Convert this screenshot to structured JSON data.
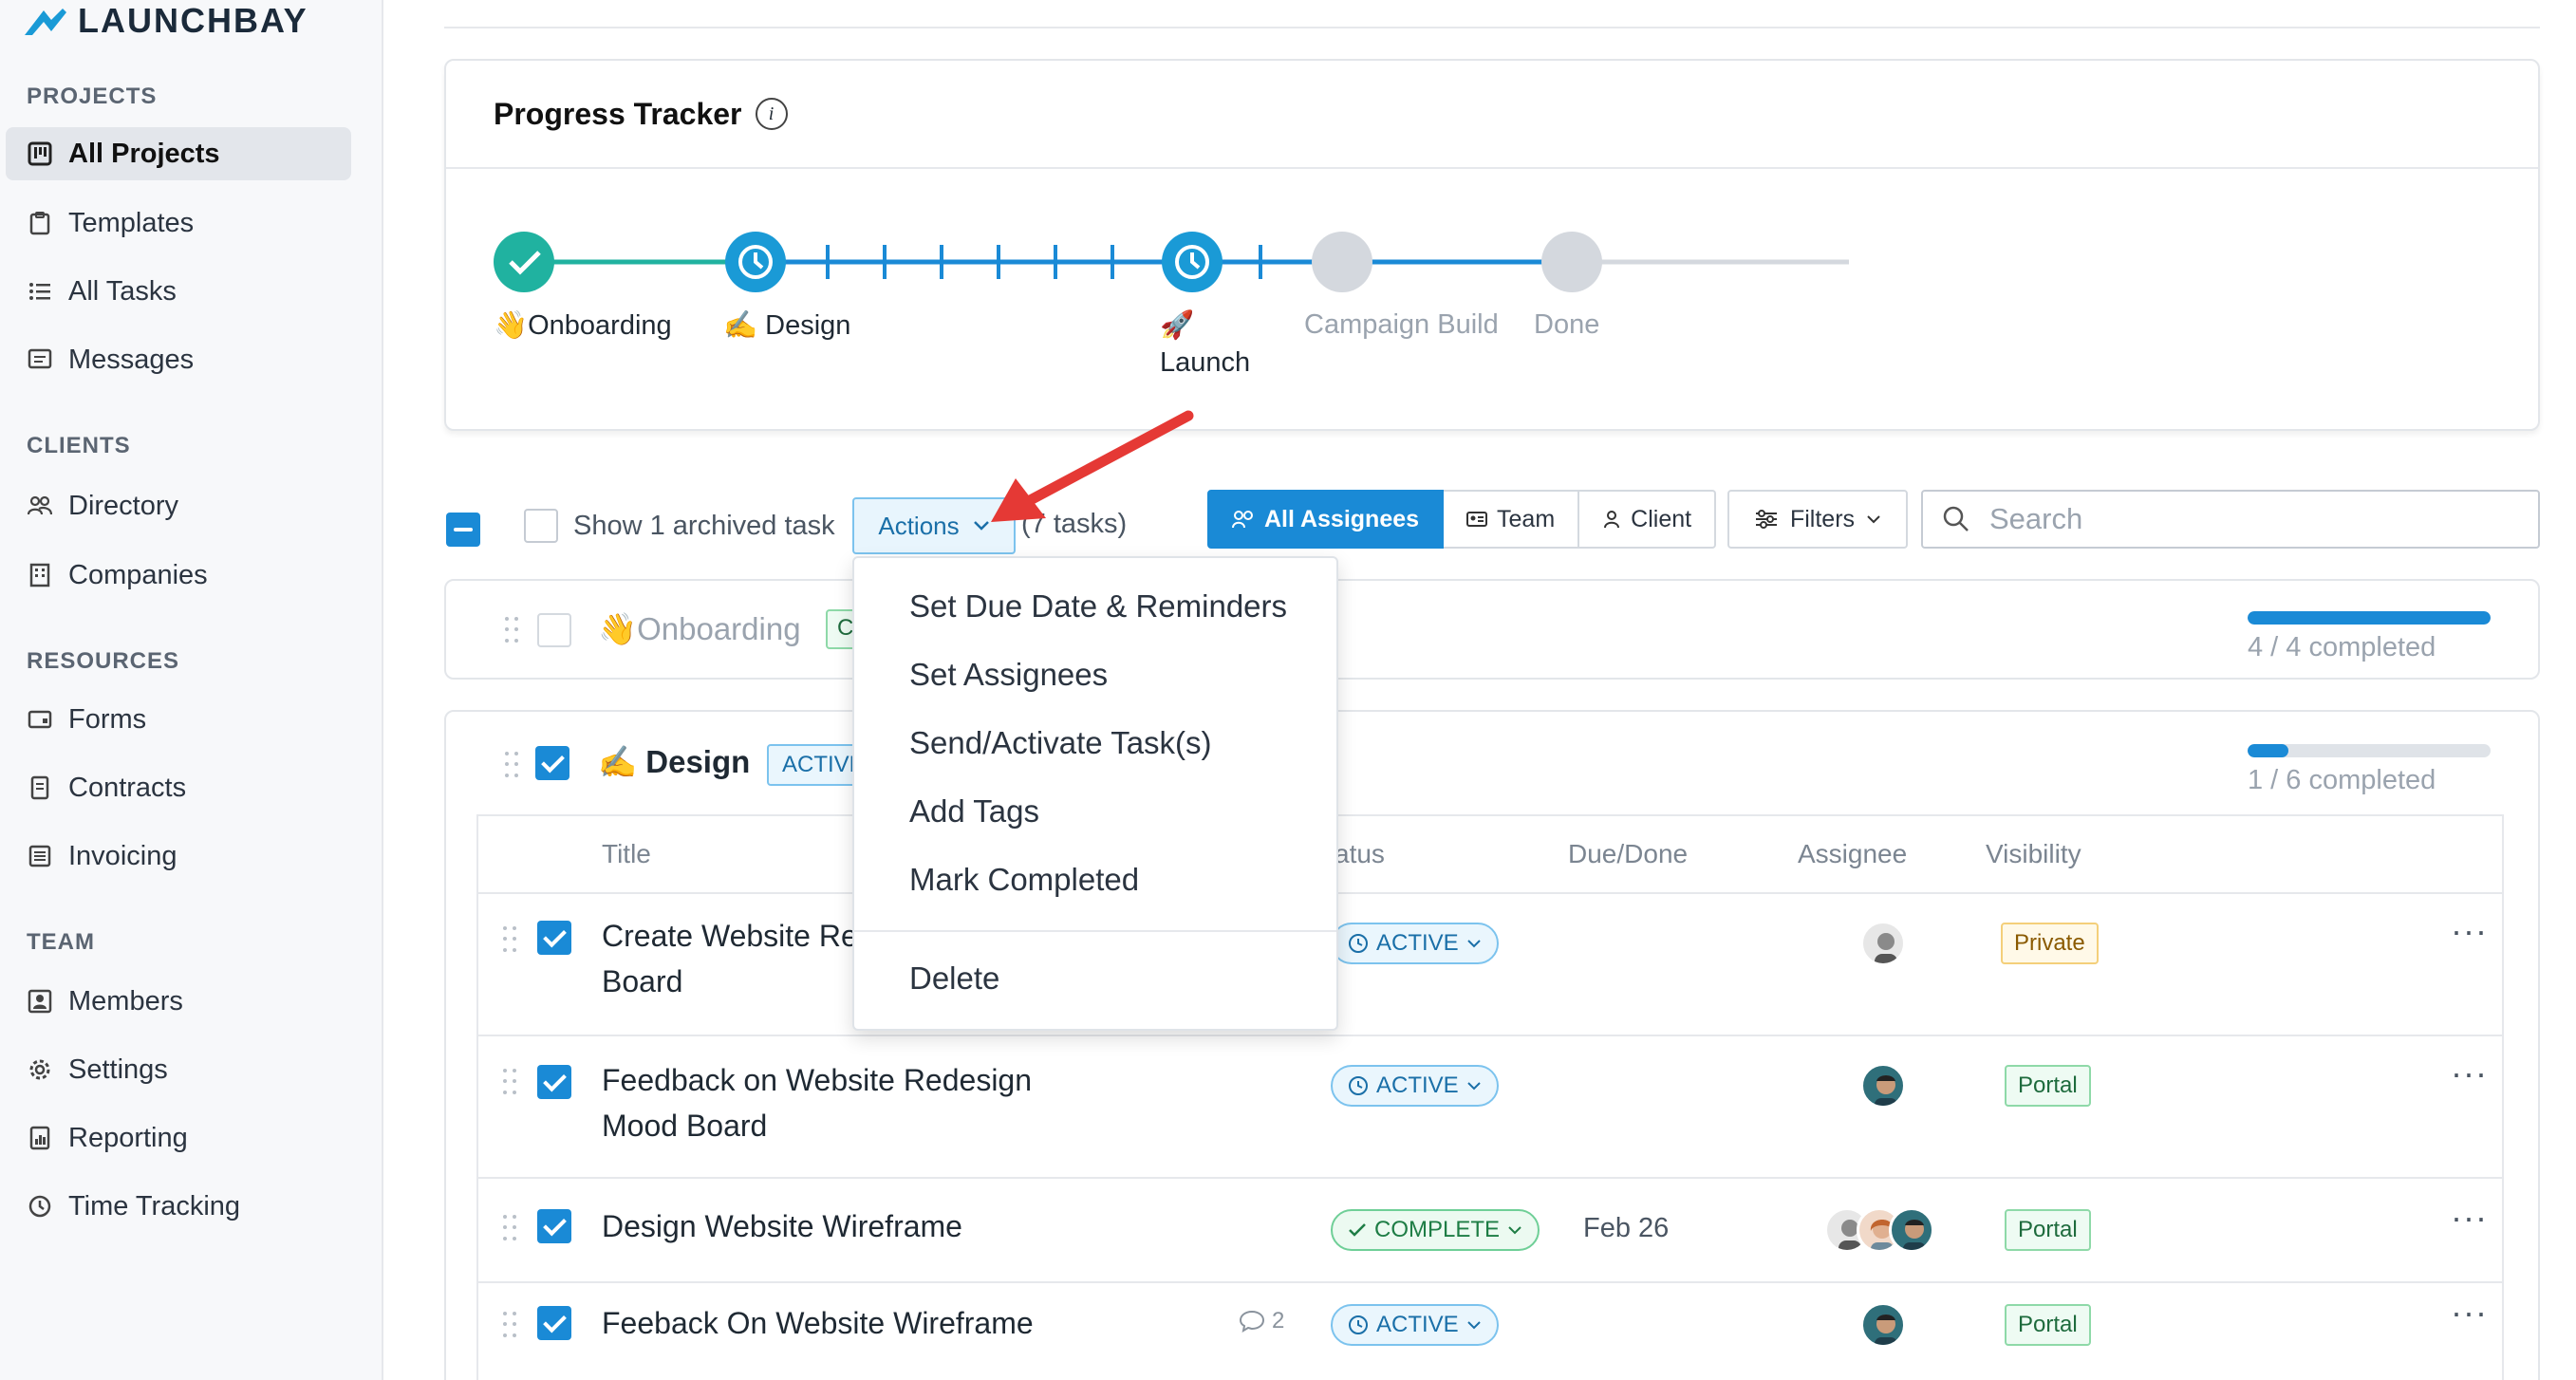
{
  "brand": {
    "name": "LAUNCHBAY"
  },
  "sidebar": {
    "sections": [
      {
        "title": "PROJECTS",
        "items": [
          {
            "label": "All Projects",
            "icon": "kanban-icon",
            "active": true
          },
          {
            "label": "Templates",
            "icon": "clipboard-icon"
          },
          {
            "label": "All Tasks",
            "icon": "list-icon"
          },
          {
            "label": "Messages",
            "icon": "message-icon"
          }
        ]
      },
      {
        "title": "CLIENTS",
        "items": [
          {
            "label": "Directory",
            "icon": "people-icon"
          },
          {
            "label": "Companies",
            "icon": "building-icon"
          }
        ]
      },
      {
        "title": "RESOURCES",
        "items": [
          {
            "label": "Forms",
            "icon": "form-icon"
          },
          {
            "label": "Contracts",
            "icon": "document-icon"
          },
          {
            "label": "Invoicing",
            "icon": "invoice-icon"
          }
        ]
      },
      {
        "title": "TEAM",
        "items": [
          {
            "label": "Members",
            "icon": "member-icon"
          },
          {
            "label": "Settings",
            "icon": "gear-icon"
          },
          {
            "label": "Reporting",
            "icon": "report-icon"
          },
          {
            "label": "Time Tracking",
            "icon": "clock-icon"
          }
        ]
      }
    ]
  },
  "tracker": {
    "title": "Progress Tracker",
    "stages": [
      {
        "label": "👋Onboarding",
        "state": "done"
      },
      {
        "label": "✍️ Design",
        "state": "active"
      },
      {
        "label": "🚀",
        "label2": "Launch",
        "state": "active"
      },
      {
        "label": "Campaign Build",
        "state": "pending"
      },
      {
        "label": "Done",
        "state": "pending"
      }
    ]
  },
  "toolbar": {
    "archived_label": "Show 1 archived task",
    "actions_label": "Actions",
    "task_count": "(7 tasks)",
    "assignee_tabs": [
      "All Assignees",
      "Team",
      "Client"
    ],
    "filters_label": "Filters",
    "search_placeholder": "Search"
  },
  "actions_menu": {
    "items": [
      "Set Due Date & Reminders",
      "Set Assignees",
      "Send/Activate Task(s)",
      "Add Tags",
      "Mark Completed"
    ],
    "danger_item": "Delete"
  },
  "groups": [
    {
      "name": "👋Onboarding",
      "badge": "C",
      "progress": 1.0,
      "progress_text": "4 / 4 completed"
    },
    {
      "name": "✍️ Design",
      "badge": "ACTIVE",
      "progress": 0.1667,
      "progress_text": "1 / 6 completed"
    }
  ],
  "table": {
    "headers": {
      "title": "Title",
      "status": "atus",
      "due": "Due/Done",
      "assignee": "Assignee",
      "visibility": "Visibility"
    },
    "rows": [
      {
        "title_line1": "Create Website Re",
        "title_line2": "Board",
        "status": "ACTIVE",
        "due": "",
        "visibility": "Private",
        "comments": ""
      },
      {
        "title_line1": "Feedback on Website Redesign",
        "title_line2": "Mood Board",
        "status": "ACTIVE",
        "due": "",
        "visibility": "Portal",
        "comments": ""
      },
      {
        "title_line1": "Design Website Wireframe",
        "title_line2": "",
        "status": "COMPLETE",
        "due": "Feb 26",
        "visibility": "Portal",
        "comments": ""
      },
      {
        "title_line1": "Feeback On Website Wireframe",
        "title_line2": "",
        "status": "ACTIVE",
        "due": "",
        "visibility": "Portal",
        "comments": "2"
      }
    ],
    "more_label": "···"
  },
  "colors": {
    "accent": "#1a8ad6",
    "done": "#20b2a0",
    "pending": "#d4d8de",
    "annotation_arrow": "#e53935"
  }
}
